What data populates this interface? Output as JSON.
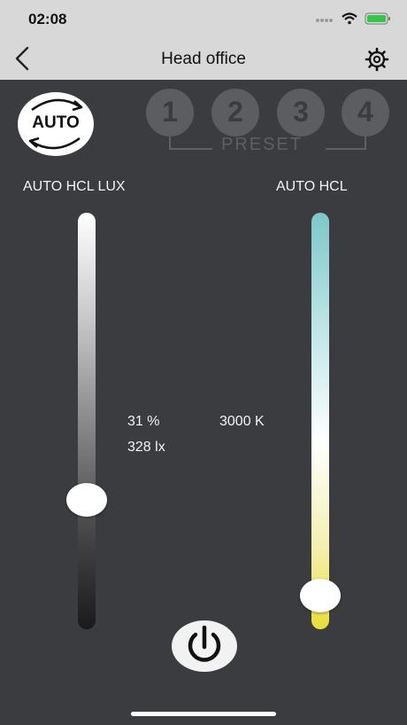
{
  "status": {
    "time": "02:08"
  },
  "nav": {
    "title": "Head office"
  },
  "auto_button": {
    "label": "AUTO"
  },
  "presets": {
    "items": [
      "1",
      "2",
      "3",
      "4"
    ],
    "label": "PRESET"
  },
  "left_slider": {
    "label": "AUTO HCL LUX",
    "level_percent": 31
  },
  "right_slider": {
    "label": "AUTO HCL",
    "level_percent": 8
  },
  "readouts": {
    "percent": "31 %",
    "lux": "328 lx",
    "kelvin": "3000 K"
  },
  "colors": {
    "background": "#3a3c3f",
    "header": "#d8d8d8",
    "preset_circle": "#5b5d60",
    "battery": "#32c748"
  }
}
